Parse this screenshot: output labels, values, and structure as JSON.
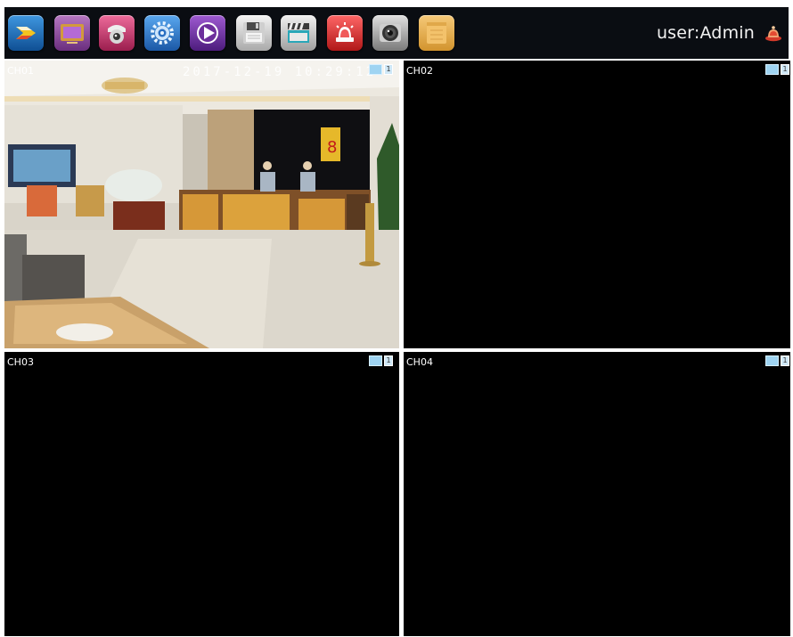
{
  "toolbar": {
    "buttons": [
      {
        "name": "main-menu",
        "icon": "arrow-logo-icon",
        "color": "#1d6fb8"
      },
      {
        "name": "display",
        "icon": "monitor-icon",
        "color": "#8a4b9a"
      },
      {
        "name": "ptz",
        "icon": "dome-camera-icon",
        "color": "#c03a6c"
      },
      {
        "name": "settings",
        "icon": "gear-icon",
        "color": "#2a6fc2"
      },
      {
        "name": "playback",
        "icon": "play-icon",
        "color": "#6d2f9c"
      },
      {
        "name": "backup",
        "icon": "floppy-disk-icon",
        "color": "#d6d6d6"
      },
      {
        "name": "record",
        "icon": "clapperboard-icon",
        "color": "#d9d9d9"
      },
      {
        "name": "alarm",
        "icon": "alarm-light-icon",
        "color": "#d63232"
      },
      {
        "name": "snapshot",
        "icon": "camera-lens-icon",
        "color": "#bdbdbd"
      },
      {
        "name": "notes",
        "icon": "notebook-icon",
        "color": "#e9b45a"
      }
    ]
  },
  "user": {
    "label": "user:Admin",
    "logout_icon": "logout-icon"
  },
  "channels": [
    {
      "id": "ch01",
      "label": "CH01",
      "timestamp": "2017-12-19  10:29:12",
      "rec_indicator": "1",
      "has_video": true
    },
    {
      "id": "ch02",
      "label": "CH02",
      "rec_indicator": "1",
      "has_video": false
    },
    {
      "id": "ch03",
      "label": "CH03",
      "rec_indicator": "1",
      "has_video": false
    },
    {
      "id": "ch04",
      "label": "CH04",
      "rec_indicator": "1",
      "has_video": false
    }
  ],
  "colors": {
    "toolbar_bg": "#0a0d12",
    "channel_bg": "#000000",
    "divider": "#ffffff"
  }
}
